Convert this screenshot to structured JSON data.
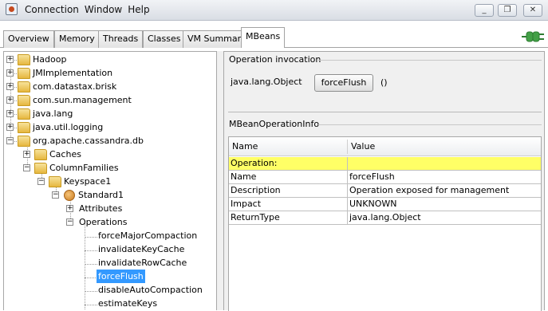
{
  "window": {
    "menu": [
      "Connection",
      "Window",
      "Help"
    ],
    "controls": {
      "minimize": "_",
      "restore": "❐",
      "close": "✕"
    }
  },
  "tabs": [
    {
      "label": "Overview"
    },
    {
      "label": "Memory"
    },
    {
      "label": "Threads"
    },
    {
      "label": "Classes"
    },
    {
      "label": "VM Summary"
    },
    {
      "label": "MBeans",
      "active": true
    }
  ],
  "tree": {
    "nodes": [
      {
        "label": "Hadoop",
        "icon": "folder-icon",
        "toggle": "+"
      },
      {
        "label": "JMImplementation",
        "icon": "folder-icon",
        "toggle": "+"
      },
      {
        "label": "com.datastax.brisk",
        "icon": "folder-icon",
        "toggle": "+"
      },
      {
        "label": "com.sun.management",
        "icon": "folder-icon",
        "toggle": "+"
      },
      {
        "label": "java.lang",
        "icon": "folder-icon",
        "toggle": "+"
      },
      {
        "label": "java.util.logging",
        "icon": "folder-icon",
        "toggle": "+"
      },
      {
        "label": "org.apache.cassandra.db",
        "icon": "folder-icon",
        "toggle": "−"
      },
      {
        "label": "Caches",
        "icon": "folder-icon",
        "toggle": "+"
      },
      {
        "label": "ColumnFamilies",
        "icon": "folder-icon",
        "toggle": "−"
      },
      {
        "label": "Keyspace1",
        "icon": "folder-icon",
        "toggle": "−"
      },
      {
        "label": "Standard1",
        "icon": "bean-icon",
        "toggle": "−"
      },
      {
        "label": "Attributes",
        "icon": "",
        "toggle": "+"
      },
      {
        "label": "Operations",
        "icon": "",
        "toggle": "−"
      },
      {
        "label": "forceMajorCompaction",
        "icon": "",
        "toggle": ""
      },
      {
        "label": "invalidateKeyCache",
        "icon": "",
        "toggle": ""
      },
      {
        "label": "invalidateRowCache",
        "icon": "",
        "toggle": ""
      },
      {
        "label": "forceFlush",
        "icon": "",
        "toggle": "",
        "selected": true
      },
      {
        "label": "disableAutoCompaction",
        "icon": "",
        "toggle": ""
      },
      {
        "label": "estimateKeys",
        "icon": "",
        "toggle": ""
      }
    ]
  },
  "invocation": {
    "heading": "Operation invocation",
    "return_type": "java.lang.Object",
    "button_label": "forceFlush",
    "params": "()"
  },
  "info": {
    "heading": "MBeanOperationInfo",
    "columns": [
      "Name",
      "Value"
    ],
    "rows": [
      {
        "name": "Operation:",
        "value": "",
        "highlight": true
      },
      {
        "name": "Name",
        "value": "forceFlush"
      },
      {
        "name": "Description",
        "value": "Operation exposed for management"
      },
      {
        "name": "Impact",
        "value": "UNKNOWN"
      },
      {
        "name": "ReturnType",
        "value": "java.lang.Object"
      }
    ]
  },
  "colors": {
    "highlight_row": "#ffff66",
    "selection": "#3399ff"
  }
}
